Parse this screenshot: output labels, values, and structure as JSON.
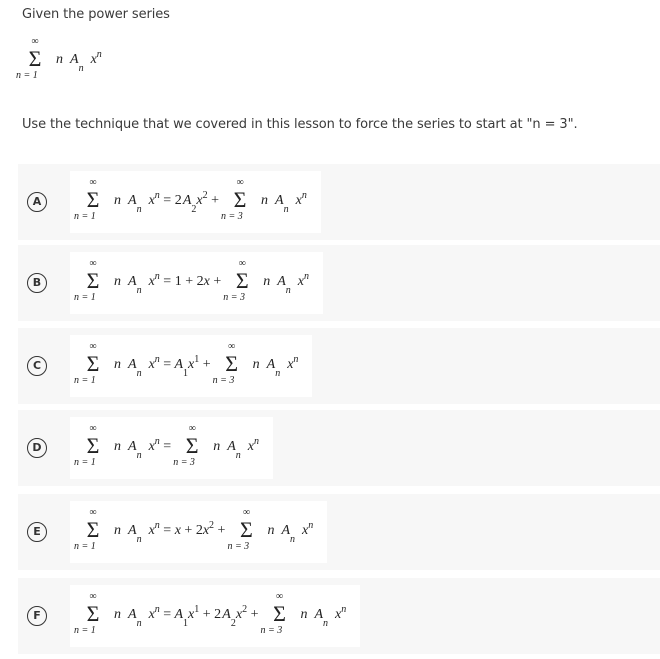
{
  "prompt": {
    "intro": "Given the power series",
    "instruction": "Use the technique that we covered in this lesson to force the series to start at \"n = 3\"."
  },
  "given_series": {
    "upper": "∞",
    "sigma": "Σ",
    "lower": "n = 1",
    "term": {
      "coef": "n",
      "A": "A",
      "sub": "n",
      "x": "x",
      "sup": "n"
    }
  },
  "options": [
    {
      "letter": "A",
      "rhs_terms": [
        "2A₂x²"
      ],
      "text": "Σ(n=1→∞) n Aₙ xⁿ = 2A₂x² + Σ(n=3→∞) n Aₙ xⁿ"
    },
    {
      "letter": "B",
      "rhs_terms": [
        "1",
        "2x"
      ],
      "text": "Σ(n=1→∞) n Aₙ xⁿ = 1 + 2x + Σ(n=3→∞) n Aₙ xⁿ"
    },
    {
      "letter": "C",
      "rhs_terms": [
        "A₁x¹"
      ],
      "text": "Σ(n=1→∞) n Aₙ xⁿ = A₁x¹ + Σ(n=3→∞) n Aₙ xⁿ"
    },
    {
      "letter": "D",
      "rhs_terms": [],
      "text": "Σ(n=1→∞) n Aₙ xⁿ = Σ(n=3→∞) n Aₙ xⁿ"
    },
    {
      "letter": "E",
      "rhs_terms": [
        "x",
        "2x²"
      ],
      "text": "Σ(n=1→∞) n Aₙ xⁿ = x + 2x² + Σ(n=3→∞) n Aₙ xⁿ"
    },
    {
      "letter": "F",
      "rhs_terms": [
        "A₁x¹",
        "2A₂x²"
      ],
      "text": "Σ(n=1→∞) n Aₙ xⁿ = A₁x¹ + 2A₂x² + Σ(n=3→∞) n Aₙ xⁿ"
    }
  ],
  "symbols": {
    "eq": "=",
    "plus": "+",
    "lower_start": "n = 1",
    "lower_new": "n = 3",
    "one": "1",
    "two": "2",
    "x": "x",
    "A": "A",
    "n": "n",
    "inf": "∞",
    "sigma": "Σ",
    "sub1": "1",
    "sub2": "2",
    "sup1": "1",
    "sup2": "2"
  },
  "colors": {
    "option_bg": "#f7f7f7",
    "card_bg": "#ffffff",
    "text": "#333333"
  }
}
